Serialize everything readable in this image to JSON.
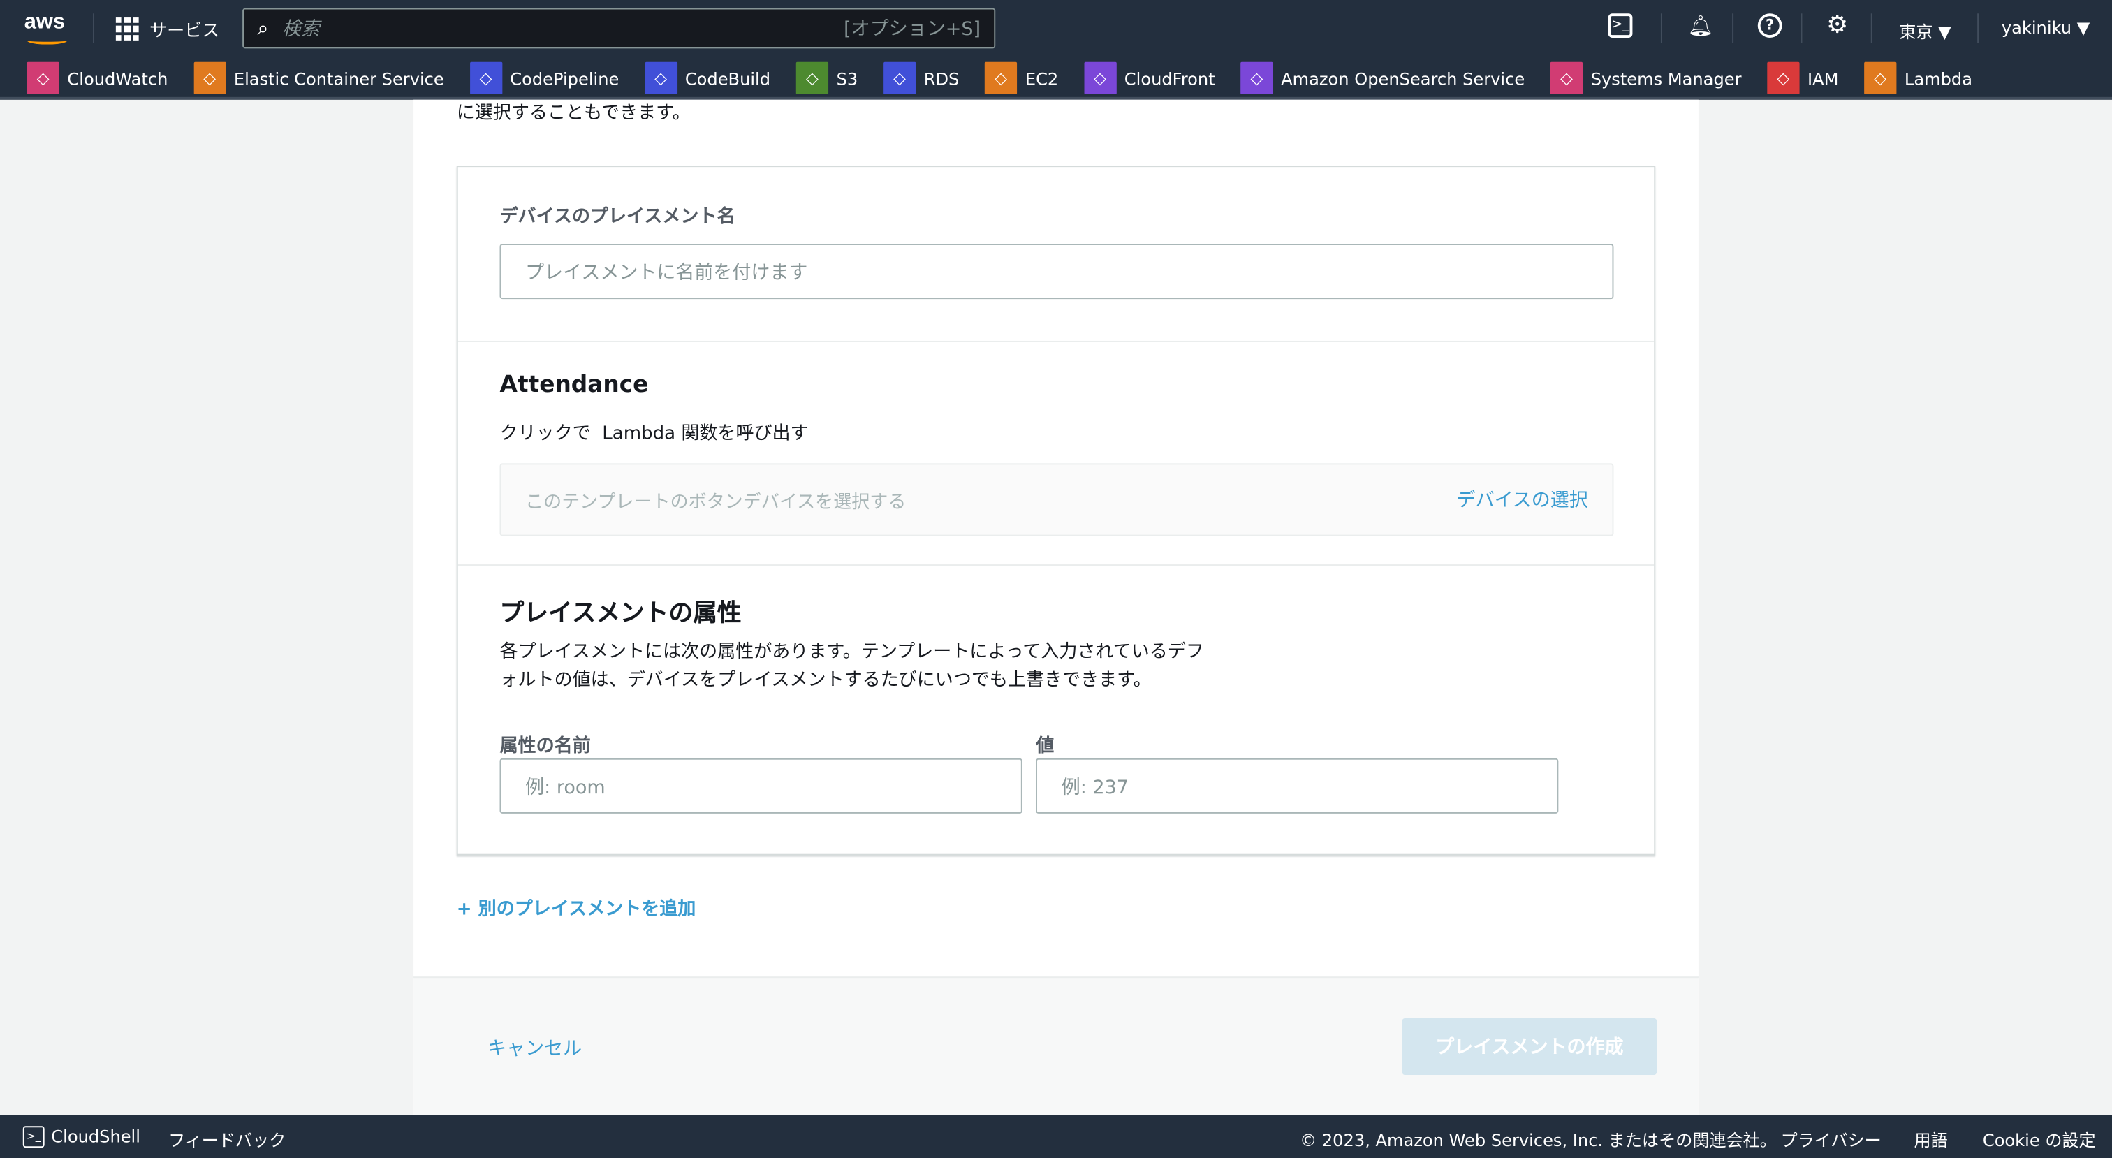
{
  "topbar": {
    "logo": "aws",
    "services": "サービス",
    "search_placeholder": "検索",
    "search_shortcut": "[オプション+S]",
    "region": "東京 ▼",
    "user": "yakiniku ▼"
  },
  "favorites": [
    {
      "label": "CloudWatch",
      "color": "#d13c73",
      "icon": "cloudwatch-icon"
    },
    {
      "label": "Elastic Container Service",
      "color": "#e07a1f",
      "icon": "ecs-icon"
    },
    {
      "label": "CodePipeline",
      "color": "#4150d8",
      "icon": "codepipeline-icon"
    },
    {
      "label": "CodeBuild",
      "color": "#4150d8",
      "icon": "codebuild-icon"
    },
    {
      "label": "S3",
      "color": "#4d8a2f",
      "icon": "s3-icon"
    },
    {
      "label": "RDS",
      "color": "#4150d8",
      "icon": "rds-icon"
    },
    {
      "label": "EC2",
      "color": "#e07a1f",
      "icon": "ec2-icon"
    },
    {
      "label": "CloudFront",
      "color": "#7b47d8",
      "icon": "cloudfront-icon"
    },
    {
      "label": "Amazon OpenSearch Service",
      "color": "#7b47d8",
      "icon": "opensearch-icon"
    },
    {
      "label": "Systems Manager",
      "color": "#d13c73",
      "icon": "systems-manager-icon"
    },
    {
      "label": "IAM",
      "color": "#d93a3a",
      "icon": "iam-icon"
    },
    {
      "label": "Lambda",
      "color": "#e07a1f",
      "icon": "lambda-icon"
    }
  ],
  "main": {
    "cut_text": "に選択することもできます。",
    "placement_name_label": "デバイスのプレイスメント名",
    "placement_name_placeholder": "プレイスメントに名前を付けます",
    "attendance_title": "Attendance",
    "attendance_desc": "クリックで  Lambda 関数を呼び出す",
    "device_placeholder": "このテンプレートのボタンデバイスを選択する",
    "device_select": "デバイスの選択",
    "attr_title": "プレイスメントの属性",
    "attr_desc1": "各プレイスメントには次の属性があります。テンプレートによって入力されているデフ",
    "attr_desc2": "ォルトの値は、デバイスをプレイスメントするたびにいつでも上書きできます。",
    "attr_name_label": "属性の名前",
    "attr_name_placeholder": "例: room",
    "value_label": "値",
    "value_placeholder": "例: 237",
    "add_placement": "+ 別のプレイスメントを追加",
    "cancel": "キャンセル",
    "create": "プレイスメントの作成"
  },
  "footer": {
    "cloudshell": "CloudShell",
    "feedback": "フィードバック",
    "copyright": "© 2023, Amazon Web Services, Inc. またはその関連会社。",
    "privacy": "プライバシー",
    "terms": "用語",
    "cookie": "Cookie の設定"
  }
}
